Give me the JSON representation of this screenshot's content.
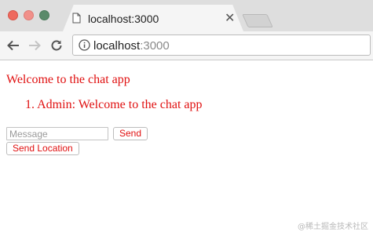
{
  "browser": {
    "tab": {
      "title": "localhost:3000"
    },
    "address_bar": {
      "host": "localhost",
      "port": ":3000"
    }
  },
  "page": {
    "heading": "Welcome to the chat app",
    "messages": [
      {
        "number": "1.",
        "text": "Admin: Welcome to the chat app"
      }
    ],
    "message_input": {
      "value": "",
      "placeholder": "Message"
    },
    "send_label": "Send",
    "send_location_label": "Send Location",
    "text_color": "#e01010"
  },
  "watermark": "@稀土掘金技术社区"
}
